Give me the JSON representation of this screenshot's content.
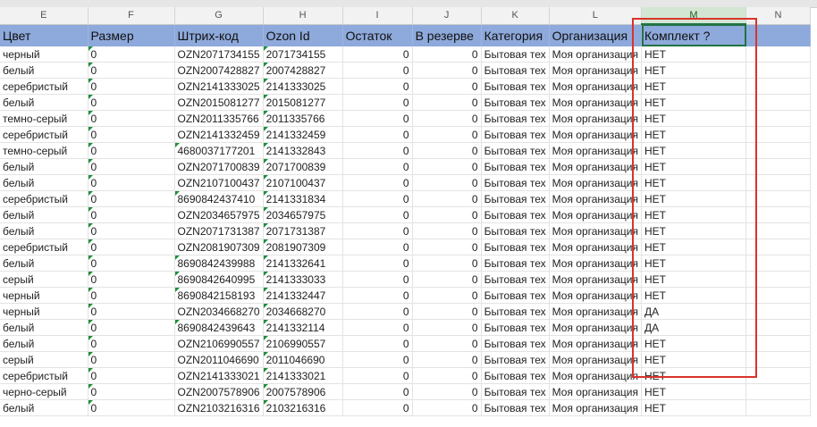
{
  "columns": [
    "E",
    "F",
    "G",
    "H",
    "I",
    "J",
    "K",
    "L",
    "M",
    "N"
  ],
  "headers": [
    "Цвет",
    "Размер",
    "Штрих-код",
    "Ozon Id",
    "Остаток",
    "В резерве",
    "Категория",
    "Организация",
    "Комплект ?",
    ""
  ],
  "rows": [
    [
      "черный",
      "0",
      "OZN2071734155",
      "2071734155",
      "0",
      "0",
      "Бытовая тех",
      "Моя организация",
      "НЕТ"
    ],
    [
      "белый",
      "0",
      "OZN2007428827",
      "2007428827",
      "0",
      "0",
      "Бытовая тех",
      "Моя организация",
      "НЕТ"
    ],
    [
      "серебристый",
      "0",
      "OZN2141333025",
      "2141333025",
      "0",
      "0",
      "Бытовая тех",
      "Моя организация",
      "НЕТ"
    ],
    [
      "белый",
      "0",
      "OZN2015081277",
      "2015081277",
      "0",
      "0",
      "Бытовая тех",
      "Моя организация",
      "НЕТ"
    ],
    [
      "темно-серый",
      "0",
      "OZN2011335766",
      "2011335766",
      "0",
      "0",
      "Бытовая тех",
      "Моя организация",
      "НЕТ"
    ],
    [
      "серебристый",
      "0",
      "OZN2141332459",
      "2141332459",
      "0",
      "0",
      "Бытовая тех",
      "Моя организация",
      "НЕТ"
    ],
    [
      "темно-серый",
      "0",
      "4680037177201",
      "2141332843",
      "0",
      "0",
      "Бытовая тех",
      "Моя организация",
      "НЕТ"
    ],
    [
      "белый",
      "0",
      "OZN2071700839",
      "2071700839",
      "0",
      "0",
      "Бытовая тех",
      "Моя организация",
      "НЕТ"
    ],
    [
      "белый",
      "0",
      "OZN2107100437",
      "2107100437",
      "0",
      "0",
      "Бытовая тех",
      "Моя организация",
      "НЕТ"
    ],
    [
      "серебристый",
      "0",
      "8690842437410",
      "2141331834",
      "0",
      "0",
      "Бытовая тех",
      "Моя организация",
      "НЕТ"
    ],
    [
      "белый",
      "0",
      "OZN2034657975",
      "2034657975",
      "0",
      "0",
      "Бытовая тех",
      "Моя организация",
      "НЕТ"
    ],
    [
      "белый",
      "0",
      "OZN2071731387",
      "2071731387",
      "0",
      "0",
      "Бытовая тех",
      "Моя организация",
      "НЕТ"
    ],
    [
      "серебристый",
      "0",
      "OZN2081907309",
      "2081907309",
      "0",
      "0",
      "Бытовая тех",
      "Моя организация",
      "НЕТ"
    ],
    [
      "белый",
      "0",
      "8690842439988",
      "2141332641",
      "0",
      "0",
      "Бытовая тех",
      "Моя организация",
      "НЕТ"
    ],
    [
      "серый",
      "0",
      "8690842640995",
      "2141333033",
      "0",
      "0",
      "Бытовая тех",
      "Моя организация",
      "НЕТ"
    ],
    [
      "черный",
      "0",
      "8690842158193",
      "2141332447",
      "0",
      "0",
      "Бытовая тех",
      "Моя организация",
      "НЕТ"
    ],
    [
      "черный",
      "0",
      "OZN2034668270",
      "2034668270",
      "0",
      "0",
      "Бытовая тех",
      "Моя организация",
      "ДА"
    ],
    [
      "белый",
      "0",
      "8690842439643",
      "2141332114",
      "0",
      "0",
      "Бытовая тех",
      "Моя организация",
      "ДА"
    ],
    [
      "белый",
      "0",
      "OZN2106990557",
      "2106990557",
      "0",
      "0",
      "Бытовая тех",
      "Моя организация",
      "НЕТ"
    ],
    [
      "серый",
      "0",
      "OZN2011046690",
      "2011046690",
      "0",
      "0",
      "Бытовая тех",
      "Моя организация",
      "НЕТ"
    ],
    [
      "серебристый",
      "0",
      "OZN2141333021",
      "2141333021",
      "0",
      "0",
      "Бытовая тех",
      "Моя организация",
      "НЕТ"
    ],
    [
      "черно-серый",
      "0",
      "OZN2007578906",
      "2007578906",
      "0",
      "0",
      "Бытовая тех",
      "Моя организация",
      "НЕТ"
    ],
    [
      "белый",
      "0",
      "OZN2103216316",
      "2103216316",
      "0",
      "0",
      "Бытовая тех",
      "Моя организация",
      "НЕТ"
    ]
  ],
  "colors": {
    "header_bg": "#8ea9db",
    "highlight_box": "#d9342b",
    "selection": "#217346"
  }
}
